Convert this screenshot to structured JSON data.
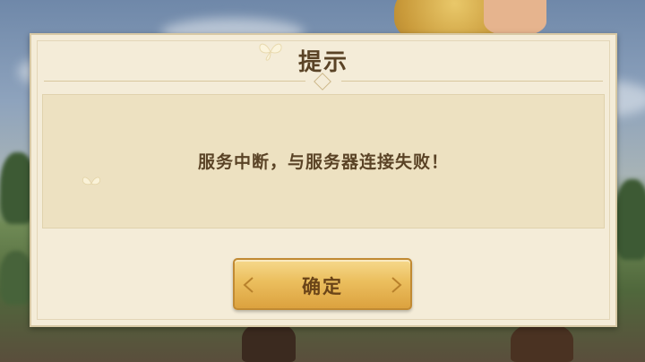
{
  "dialog": {
    "title": "提示",
    "message": "服务中断，与服务器连接失败！",
    "confirm_label": "确定"
  },
  "icons": [
    "butterfly-icon",
    "chevron-left-icon",
    "chevron-right-icon",
    "diamond-ornament-icon"
  ],
  "colors": {
    "dialog_bg": "#f4ecd8",
    "panel_bg": "#ede1c1",
    "text": "#5a4326",
    "button_gold": "#ebbe5d"
  }
}
